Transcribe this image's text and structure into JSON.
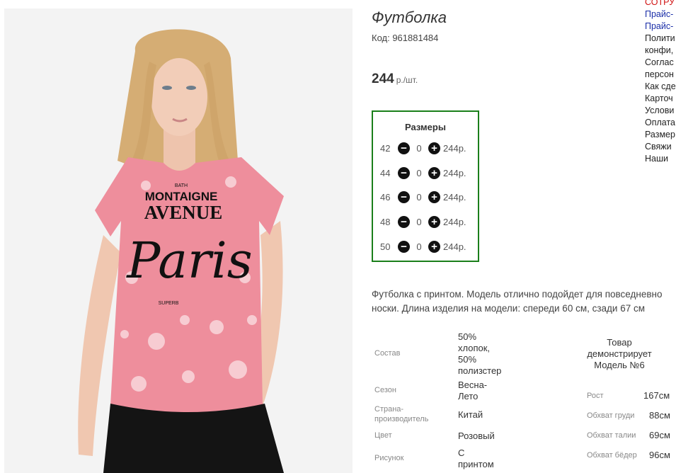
{
  "product": {
    "title": "Футболка",
    "code": "Код: 961881484",
    "price": "244",
    "price_unit": "р./шт."
  },
  "sizes": {
    "title": "Размеры",
    "minus_glyph": "−",
    "plus_glyph": "+",
    "rows": [
      {
        "size": "42",
        "qty": "0",
        "price": "244р."
      },
      {
        "size": "44",
        "qty": "0",
        "price": "244р."
      },
      {
        "size": "46",
        "qty": "0",
        "price": "244р."
      },
      {
        "size": "48",
        "qty": "0",
        "price": "244р."
      },
      {
        "size": "50",
        "qty": "0",
        "price": "244р."
      }
    ]
  },
  "description": {
    "line1": "Футболка с принтом. Модель отлично подойдет для повседневно",
    "line2": "носки. Длина изделия на модели: спереди 60 см, сзади 67 см"
  },
  "specs": [
    {
      "label": "Состав",
      "value_lines": [
        "50%",
        "хлопок,",
        "50%",
        "полизстер"
      ]
    },
    {
      "label": "Сезон",
      "value_lines": [
        "Весна-",
        "Лето"
      ]
    },
    {
      "label_lines": [
        "Страна-",
        "производитель"
      ],
      "value_lines": [
        "Китай"
      ]
    },
    {
      "label": "Цвет",
      "value_lines": [
        "Розовый"
      ]
    },
    {
      "label": "Рисунок",
      "value_lines": [
        "С",
        "принтом"
      ]
    }
  ],
  "model": {
    "heading_lines": [
      "Товар",
      "демонстрирует",
      "Модель №6"
    ],
    "params": [
      {
        "label": "Рост",
        "value": "167см"
      },
      {
        "label": "Обхват груди",
        "value": "88см"
      },
      {
        "label": "Обхват талии",
        "value": "69см"
      },
      {
        "label": "Обхват бёдер",
        "value": "96см"
      }
    ]
  },
  "side_menu": [
    {
      "text": "СОТРУ",
      "color": "red"
    },
    {
      "text": "Прайс-",
      "color": "blue"
    },
    {
      "text": "Прайс-",
      "color": "blue"
    },
    {
      "text": "Полити",
      "color": "black"
    },
    {
      "text": "конфи,",
      "color": "black"
    },
    {
      "text": "Соглас",
      "color": "black"
    },
    {
      "text": "персон",
      "color": "black"
    },
    {
      "text": "Как сде",
      "color": "black"
    },
    {
      "text": "Карточ",
      "color": "black"
    },
    {
      "text": "Услови",
      "color": "black"
    },
    {
      "text": "Оплата",
      "color": "black"
    },
    {
      "text": "Размер",
      "color": "black"
    },
    {
      "text": "Свяжи",
      "color": "black"
    },
    {
      "text": "Наши ",
      "color": "black"
    }
  ],
  "photo_print": {
    "small_top": "BATH",
    "line1": "MONTAIGNE",
    "line2": "AVENUE",
    "script": "Paris",
    "small_bottom": "SUPERB"
  },
  "colors": {
    "shirt": "#ee8e9c",
    "leggings": "#141414",
    "hair": "#d8b27a",
    "skin": "#f2cdb8",
    "border_green": "#1a7f1a"
  }
}
